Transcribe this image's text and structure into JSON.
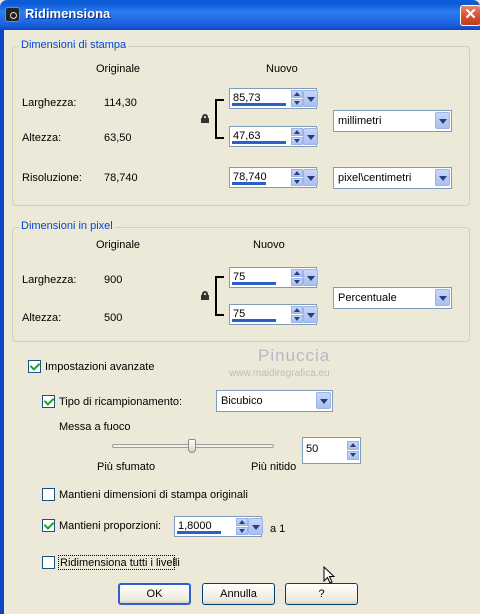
{
  "window": {
    "title": "Ridimensiona"
  },
  "print_size": {
    "legend": "Dimensioni di stampa",
    "col_original": "Originale",
    "col_new": "Nuovo",
    "width_label": "Larghezza:",
    "width_original": "114,30",
    "width_new": "85,73",
    "height_label": "Altezza:",
    "height_original": "63,50",
    "height_new": "47,63",
    "unit": "millimetri",
    "resolution_label": "Risoluzione:",
    "resolution_original": "78,740",
    "resolution_new": "78,740",
    "resolution_unit": "pixel\\centimetri"
  },
  "pixel_size": {
    "legend": "Dimensioni in pixel",
    "col_original": "Originale",
    "col_new": "Nuovo",
    "width_label": "Larghezza:",
    "width_original": "900",
    "width_new": "75",
    "height_label": "Altezza:",
    "height_original": "500",
    "height_new": "75",
    "unit": "Percentuale"
  },
  "advanced": {
    "advanced_label": "Impostazioni avanzate",
    "advanced_checked": true,
    "resample_label": "Tipo di ricampionamento:",
    "resample_checked": true,
    "resample_value": "Bicubico",
    "sharpen_label": "Messa a fuoco",
    "sharpen_left": "Più sfumato",
    "sharpen_right": "Più nitido",
    "sharpen_value": "50",
    "keep_print_label": "Mantieni dimensioni di stampa originali",
    "keep_print_checked": false,
    "keep_ratio_label": "Mantieni proporzioni:",
    "keep_ratio_checked": true,
    "ratio_value": "1,8000",
    "ratio_suffix": "a 1",
    "resize_all_label": "Ridimensiona tutti i livelli",
    "resize_all_checked": false
  },
  "watermark": {
    "line1": "Pinuccia",
    "line2": "www.maidiregrafica.eu"
  },
  "buttons": {
    "ok": "OK",
    "cancel": "Annulla",
    "help": "?"
  }
}
